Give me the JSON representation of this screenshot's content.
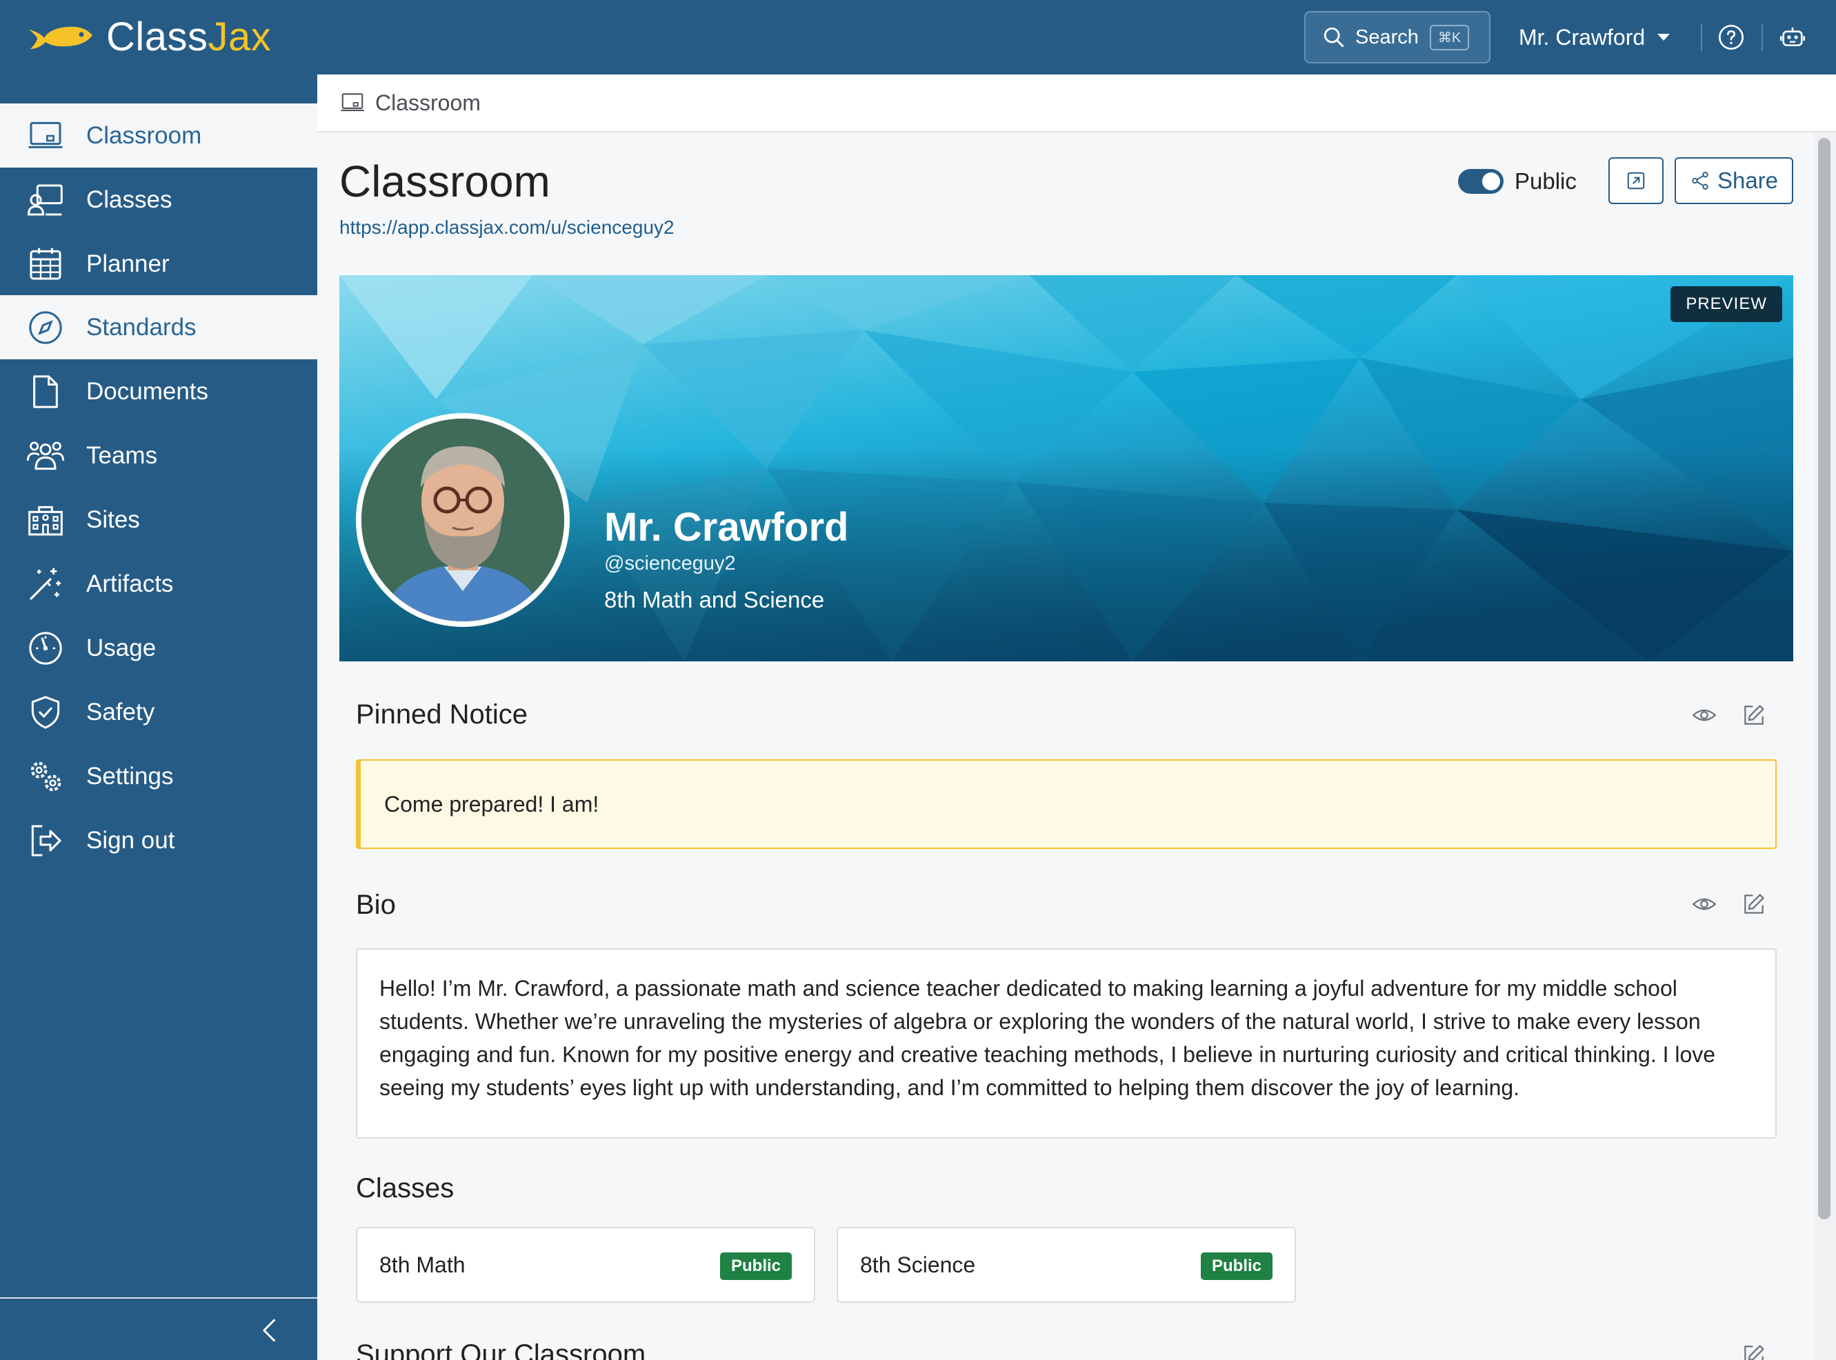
{
  "app": {
    "brand_main": "Class",
    "brand_accent": "Jax",
    "brand_color": "#265b86",
    "accent_color": "#f5c328"
  },
  "topbar": {
    "search_label": "Search",
    "search_shortcut": "⌘K",
    "user_name": "Mr. Crawford",
    "help_icon": "question-circle-icon",
    "bot_icon": "robot-icon"
  },
  "sidebar": {
    "items": [
      {
        "label": "Classroom",
        "icon": "classroom-icon",
        "active": true
      },
      {
        "label": "Classes",
        "icon": "classes-icon",
        "active": false
      },
      {
        "label": "Planner",
        "icon": "calendar-icon",
        "active": false
      },
      {
        "label": "Standards",
        "icon": "compass-icon",
        "active": true
      },
      {
        "label": "Documents",
        "icon": "document-icon",
        "active": false
      },
      {
        "label": "Teams",
        "icon": "teams-icon",
        "active": false
      },
      {
        "label": "Sites",
        "icon": "sites-icon",
        "active": false
      },
      {
        "label": "Artifacts",
        "icon": "magic-wand-icon",
        "active": false
      },
      {
        "label": "Usage",
        "icon": "gauge-icon",
        "active": false
      },
      {
        "label": "Safety",
        "icon": "shield-icon",
        "active": false
      },
      {
        "label": "Settings",
        "icon": "gears-icon",
        "active": false
      },
      {
        "label": "Sign out",
        "icon": "sign-out-icon",
        "active": false
      }
    ]
  },
  "breadcrumb": {
    "current": "Classroom"
  },
  "header": {
    "title": "Classroom",
    "url": "https://app.classjax.com/u/scienceguy2",
    "visibility_label": "Public",
    "visibility_on": true,
    "share_label": "Share"
  },
  "hero": {
    "badge": "PREVIEW",
    "name": "Mr. Crawford",
    "handle": "@scienceguy2",
    "subtitle": "8th Math and Science"
  },
  "pinned_notice": {
    "title": "Pinned Notice",
    "text": "Come prepared! I am!"
  },
  "bio": {
    "title": "Bio",
    "text": "Hello! I’m Mr. Crawford, a passionate math and science teacher dedicated to making learning a joyful adventure for my middle school students. Whether we’re unraveling the mysteries of algebra or exploring the wonders of the natural world, I strive to make every lesson engaging and fun. Known for my positive energy and creative teaching methods, I believe in nurturing curiosity and critical thinking. I love seeing my students’ eyes light up with understanding, and I’m committed to helping them discover the joy of learning."
  },
  "classes": {
    "title": "Classes",
    "items": [
      {
        "name": "8th Math",
        "badge": "Public"
      },
      {
        "name": "8th Science",
        "badge": "Public"
      }
    ]
  },
  "support": {
    "title": "Support Our Classroom"
  }
}
